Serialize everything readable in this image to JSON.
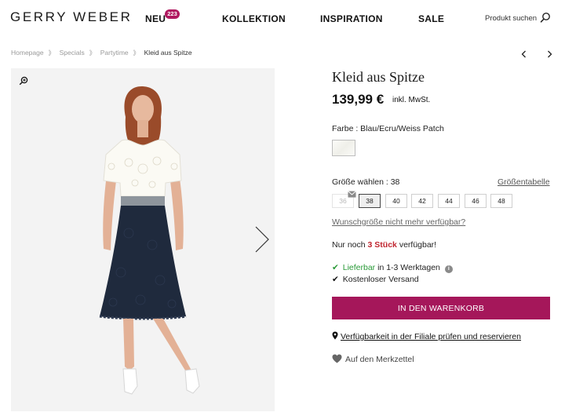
{
  "header": {
    "logo": "GERRY WEBER",
    "nav": {
      "neu": "NEU",
      "neu_badge": "223",
      "kollektion": "KOLLEKTION",
      "inspiration": "INSPIRATION",
      "sale": "SALE"
    },
    "search_label": "Produkt suchen",
    "icons": {
      "search": "search-icon"
    }
  },
  "breadcrumb": {
    "items": [
      "Homepage",
      "Specials",
      "Partytime"
    ],
    "current": "Kleid aus Spitze",
    "separator": "》"
  },
  "pager_icons": {
    "prev": "chevron-left-icon",
    "next": "chevron-right-icon"
  },
  "gallery": {
    "icons": {
      "zoom": "zoom-in-icon",
      "next": "chevron-right-icon"
    }
  },
  "product": {
    "title": "Kleid aus Spitze",
    "price": "139,99 €",
    "vat_note": "inkl. MwSt.",
    "color_label": "Farbe : Blau/Ecru/Weiss Patch",
    "size_label": "Größe wählen : 38",
    "size_table_link": "Größentabelle",
    "sizes": [
      {
        "label": "36",
        "state": "unavailable"
      },
      {
        "label": "38",
        "state": "selected"
      },
      {
        "label": "40",
        "state": "available"
      },
      {
        "label": "42",
        "state": "available"
      },
      {
        "label": "44",
        "state": "available"
      },
      {
        "label": "46",
        "state": "available"
      },
      {
        "label": "48",
        "state": "available"
      }
    ],
    "wish_size_link": "Wunschgröße nicht mehr verfügbar?",
    "stock": {
      "prefix": "Nur noch",
      "count": "3 Stück",
      "suffix": "verfügbar!"
    },
    "delivery": {
      "status": "Lieferbar",
      "time": "in 1-3 Werktagen",
      "shipping": "Kostenloser Versand"
    },
    "cart_button": "IN DEN WARENKORB",
    "store_check": "Verfügbarkeit in der Filiale prüfen und reservieren",
    "wishlist": "Auf den Merkzettel"
  },
  "colors": {
    "brand": "#a5175a",
    "badge": "#b0185f",
    "stock_highlight": "#c0252f",
    "available_green": "#2a9a38"
  }
}
